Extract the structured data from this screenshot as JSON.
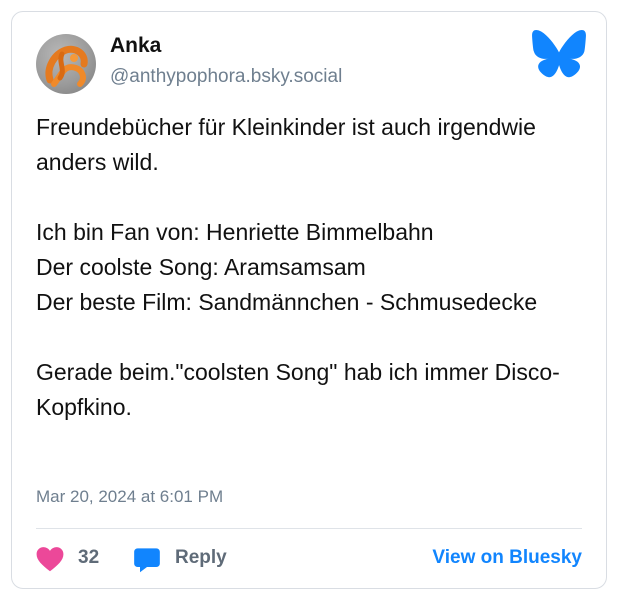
{
  "post": {
    "author_name": "Anka",
    "author_handle": "@anthypophora.bsky.social",
    "text": "Freundebücher für Kleinkinder ist auch irgendwie anders wild.\n\nIch bin Fan von: Henriette Bimmelbahn\nDer coolste Song: Aramsamsam\nDer beste Film: Sandmännchen - Schmusedecke\n\nGerade beim.\"coolsten Song\" hab ich immer Disco-Kopfkino.",
    "timestamp": "Mar 20, 2024 at 6:01 PM"
  },
  "footer": {
    "like_count": "32",
    "reply_label": "Reply",
    "view_link": "View on Bluesky"
  },
  "icons": {
    "logo": "bluesky-butterfly-icon",
    "like": "heart-icon",
    "reply": "speech-bubble-icon"
  },
  "colors": {
    "brand": "#1185fe",
    "like": "#ec4899",
    "reply": "#1185fe"
  }
}
